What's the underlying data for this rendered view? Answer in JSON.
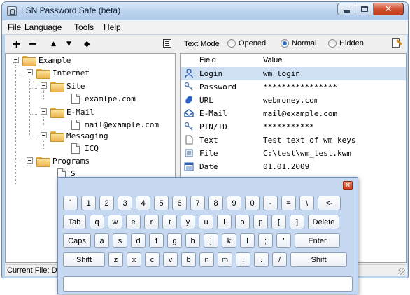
{
  "window": {
    "title": "LSN Password Safe (beta)"
  },
  "menu": [
    {
      "label": "File"
    },
    {
      "label": "Language"
    },
    {
      "label": "Tools"
    },
    {
      "label": "Help"
    }
  ],
  "left_toolbar": {
    "add": "+",
    "remove": "−",
    "up": "▲",
    "down": "▼",
    "sort": "◆"
  },
  "tree": [
    {
      "label": "Example"
    },
    {
      "label": "Internet"
    },
    {
      "label": "Site"
    },
    {
      "label": "examlpe.com"
    },
    {
      "label": "E-Mail"
    },
    {
      "label": "mail@example.com"
    },
    {
      "label": "Messaging"
    },
    {
      "label": "ICQ"
    },
    {
      "label": "Programs"
    },
    {
      "label": "S"
    }
  ],
  "text_mode": {
    "label": "Text Mode",
    "options": [
      "Opened",
      "Normal",
      "Hidden"
    ],
    "selected": "Normal"
  },
  "grid": {
    "columns": [
      "Field",
      "Value"
    ],
    "rows": [
      {
        "icon": "user-icon",
        "field": "Login",
        "value": "wm_login"
      },
      {
        "icon": "key-icon",
        "field": "Password",
        "value": "****************"
      },
      {
        "icon": "globe-icon",
        "field": "URL",
        "value": "webmoney.com"
      },
      {
        "icon": "mail-icon",
        "field": "E-Mail",
        "value": "mail@example.com"
      },
      {
        "icon": "key-icon",
        "field": "PIN/ID",
        "value": "***********"
      },
      {
        "icon": "text-icon",
        "field": "Text",
        "value": "Test text of wm keys"
      },
      {
        "icon": "file-icon",
        "field": "File",
        "value": "C:\\test\\wm_test.kwm"
      },
      {
        "icon": "calendar-icon",
        "field": "Date",
        "value": "01.01.2009"
      }
    ]
  },
  "status": {
    "text": "Current File: D"
  },
  "keyboard": {
    "rows": [
      [
        "`",
        "1",
        "2",
        "3",
        "4",
        "5",
        "6",
        "7",
        "8",
        "9",
        "0",
        "-",
        "=",
        "\\",
        "<-"
      ],
      [
        "Tab",
        "q",
        "w",
        "e",
        "r",
        "t",
        "y",
        "u",
        "i",
        "o",
        "p",
        "[",
        "]",
        "Delete"
      ],
      [
        "Caps",
        "a",
        "s",
        "d",
        "f",
        "g",
        "h",
        "j",
        "k",
        "l",
        ";",
        "'",
        "Enter"
      ],
      [
        "Shift",
        "z",
        "x",
        "c",
        "v",
        "b",
        "n",
        "m",
        ",",
        ".",
        "/",
        "Shift"
      ]
    ]
  }
}
